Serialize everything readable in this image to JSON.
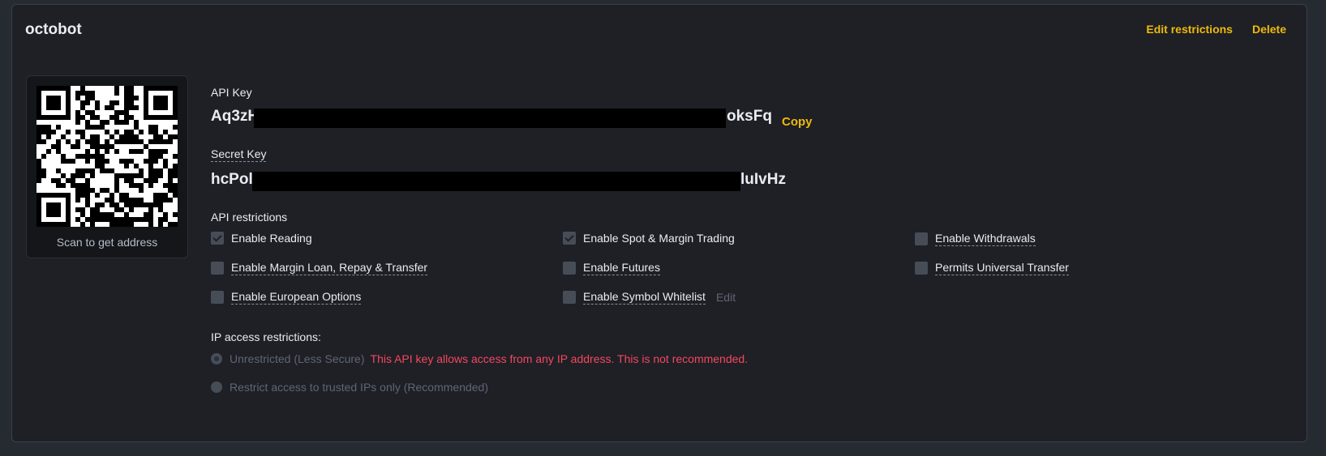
{
  "card": {
    "title": "octobot",
    "edit_label": "Edit restrictions",
    "delete_label": "Delete"
  },
  "qr": {
    "caption": "Scan to get address"
  },
  "api_key": {
    "label": "API Key",
    "prefix": "Aq3zH",
    "suffix": "oksFq",
    "copy_label": "Copy"
  },
  "secret_key": {
    "label": "Secret Key",
    "prefix": "hcPol",
    "suffix": "luIvHz"
  },
  "restrictions": {
    "label": "API restrictions",
    "options": [
      {
        "label": "Enable Reading",
        "checked": true
      },
      {
        "label": "Enable Spot & Margin Trading",
        "checked": true
      },
      {
        "label": "Enable Withdrawals",
        "checked": false
      },
      {
        "label": "Enable Margin Loan, Repay & Transfer",
        "checked": false
      },
      {
        "label": "Enable Futures",
        "checked": false
      },
      {
        "label": "Permits Universal Transfer",
        "checked": false
      },
      {
        "label": "Enable European Options",
        "checked": false
      },
      {
        "label": "Enable Symbol Whitelist",
        "checked": false,
        "edit_label": "Edit"
      }
    ]
  },
  "ip": {
    "label": "IP access restrictions:",
    "unrestricted_label": "Unrestricted (Less Secure)",
    "warning": "This API key allows access from any IP address. This is not recommended.",
    "restricted_label": "Restrict access to trusted IPs only (Recommended)"
  },
  "colors": {
    "accent": "#f0b90b",
    "warning": "#f6465d",
    "card_bg": "#1e2026"
  }
}
